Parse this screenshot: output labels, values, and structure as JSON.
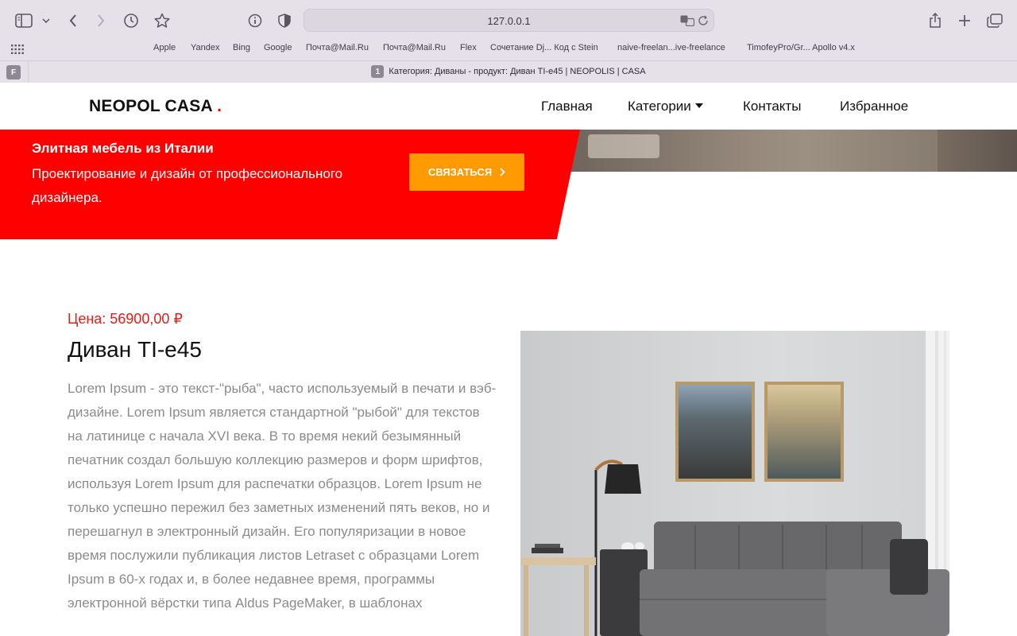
{
  "browser": {
    "url": "127.0.0.1",
    "bookmarks": [
      "Apple",
      "Yandex",
      "Bing",
      "Google",
      "Почта@Mail.Ru",
      "Почта@Mail.Ru",
      "Flex",
      "Сочетание Dj... Код с Stein",
      "naive-freelan...ive-freelance",
      "TimofeyPro/Gr... Apollo v4.x"
    ],
    "tab": {
      "favicon_letter": "F",
      "badge": "1",
      "title": "Категория: Диваны - продукт: Диван TI-e45 | NEOPOLIS | CASA"
    }
  },
  "nav": {
    "logo_text": "NEOPOL CASA",
    "logo_dot": ".",
    "items": [
      "Главная",
      "Категории",
      "Контакты",
      "Избранное"
    ]
  },
  "hero": {
    "title": "Элитная мебель из Италии",
    "subtitle": "Проектирование и дизайн от профессионального дизайнера.",
    "button_label": "СВЯЗАТЬСЯ"
  },
  "product": {
    "price": "Цена: 56900,00 ₽",
    "name": "Диван TI-e45",
    "description": "Lorem Ipsum - это текст-\"рыба\", часто используемый в печати и вэб-дизайне. Lorem Ipsum является стандартной \"рыбой\" для текстов на латинице с начала XVI века. В то время некий безымянный печатник создал большую коллекцию размеров и форм шрифтов, используя Lorem Ipsum для распечатки образцов. Lorem Ipsum не только успешно пережил без заметных изменений пять веков, но и перешагнул в электронный дизайн. Его популяризации в новое время послужили публикация листов Letraset с образцами Lorem Ipsum в 60-х годах и, в более недавнее время, программы электронной вёрстки типа Aldus PageMaker, в шаблонах"
  },
  "colors": {
    "brand_red": "#ff0000",
    "button_orange": "#ff9a00",
    "price_red": "#e0201a",
    "text_gray": "#8b8b8b"
  },
  "icons": [
    "sidebar-icon",
    "chevron-down-icon",
    "back-icon",
    "forward-icon",
    "history-icon",
    "star-icon",
    "info-icon",
    "shield-icon",
    "translate-icon",
    "reload-icon",
    "share-icon",
    "plus-icon",
    "tabs-icon",
    "grid-icon",
    "chevron-right-icon"
  ]
}
